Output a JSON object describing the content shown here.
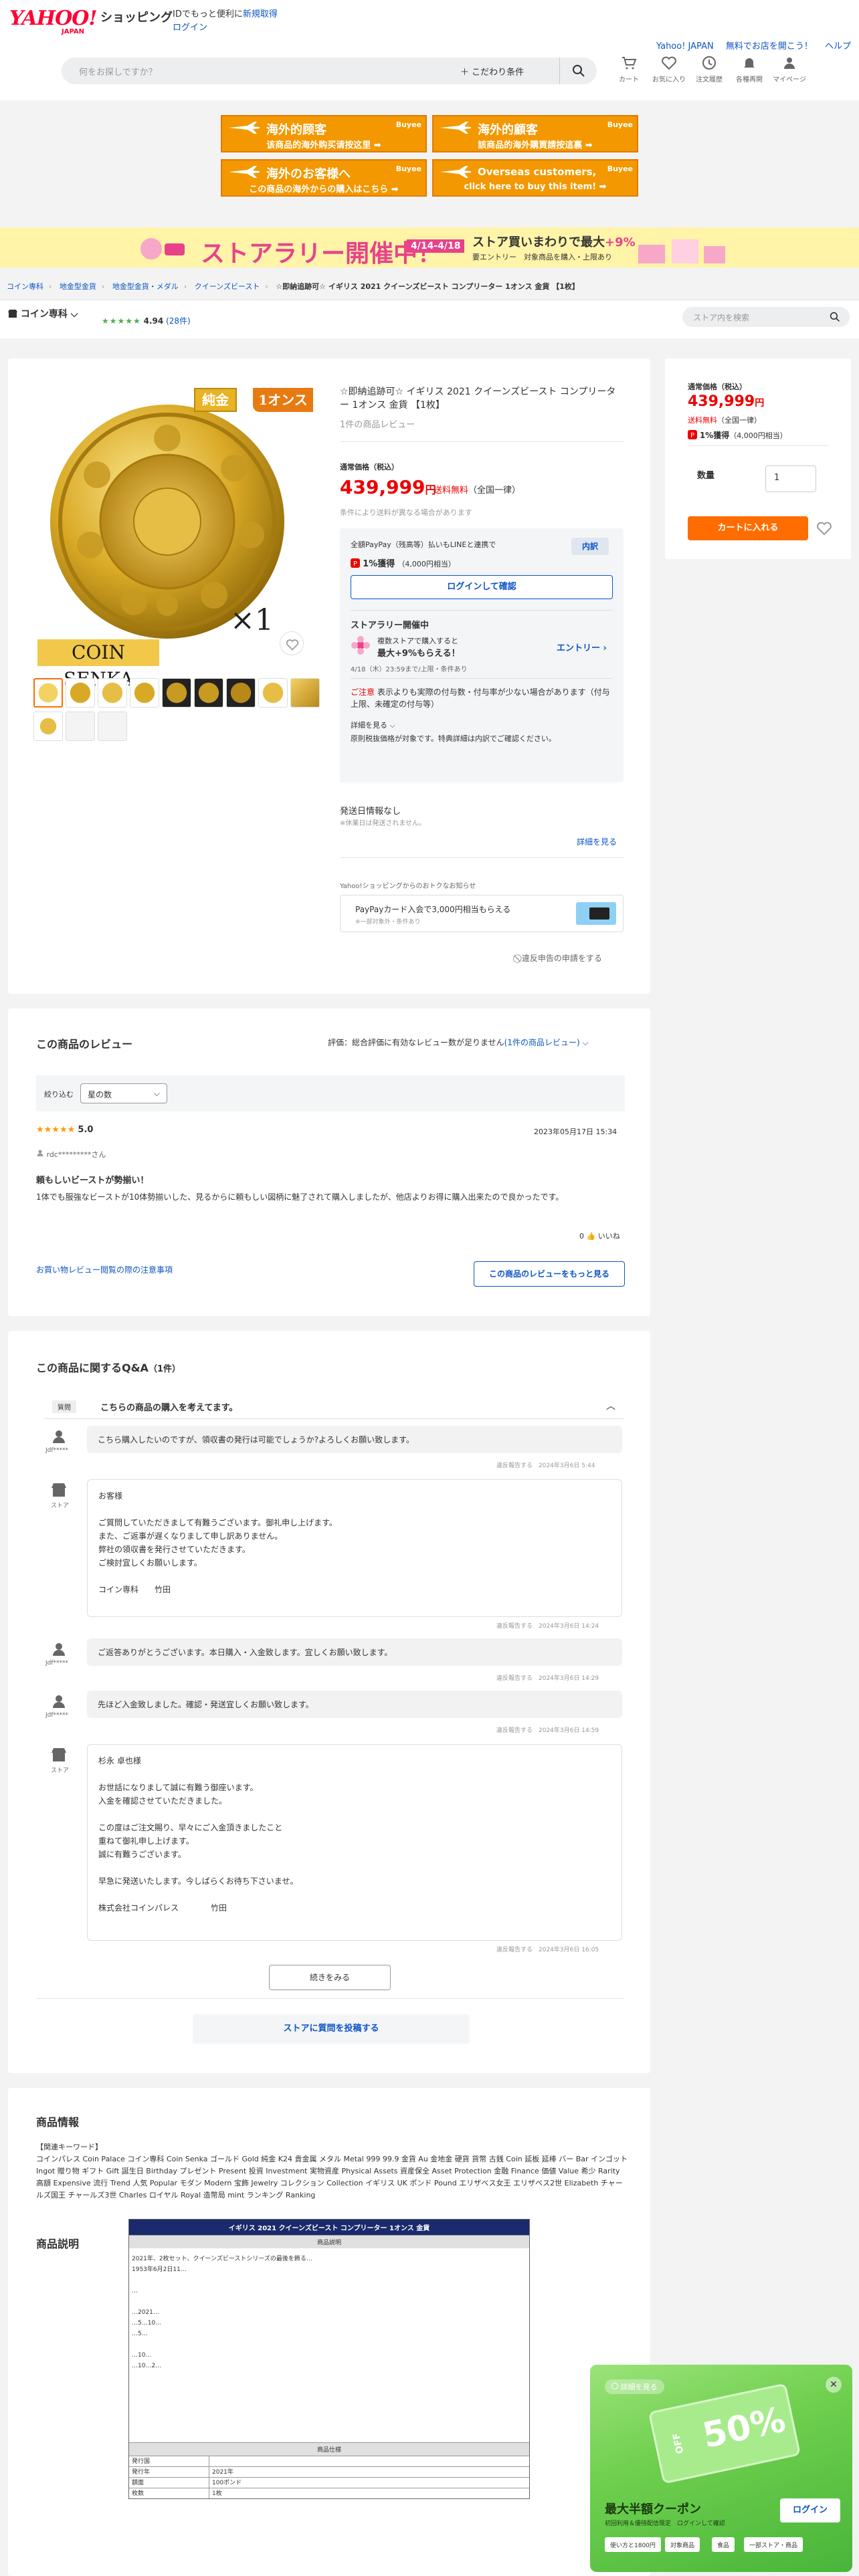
{
  "header": {
    "logo": "YAHOO!",
    "logo_sub": "JAPAN",
    "shopping": "ショッピング",
    "msg_prefix": "IDでもっと便利に",
    "msg_link": "新規取得",
    "login": "ログイン",
    "right_links": [
      "Yahoo! JAPAN",
      "無料でお店を開こう！",
      "ヘルプ"
    ],
    "search_placeholder": "何をお探しですか？",
    "search_condition": "＋ こだわり条件",
    "icons": [
      {
        "name": "cart",
        "label": "カート"
      },
      {
        "name": "favorite",
        "label": "お気に入り"
      },
      {
        "name": "history",
        "label": "注文履歴"
      },
      {
        "name": "notification",
        "label": "各種再開"
      },
      {
        "name": "mypage",
        "label": "マイページ"
      }
    ]
  },
  "banners": [
    {
      "title": "海外的顾客",
      "sub": "该商品的海外购买请按这里 ➡",
      "brand": "Buyee"
    },
    {
      "title": "海外的顧客",
      "sub": "該商品的海外購買請按這裏 ➡",
      "brand": "Buyee"
    },
    {
      "title": "海外のお客様へ",
      "sub": "この商品の海外からの購入はこちら ➡",
      "brand": "Buyee"
    },
    {
      "title": "Overseas customers,",
      "sub": "click here to buy this item! ➡",
      "brand": "Buyee"
    }
  ],
  "rally": {
    "title": "ストアラリー開催中！",
    "date": "4/14-4/18",
    "line1_a": "ストア買いまわりで最大",
    "line1_b": "+9%",
    "line2": "要エントリー　対象商品を購入・上限あり"
  },
  "breadcrumb": [
    "コイン専科",
    "地金型金貨",
    "地金型金貨・メダル",
    "クイーンズビースト",
    "☆即納追跡可☆ イギリス 2021 クイーンズビースト コンプリーター 1オンス 金貨 【1枚】"
  ],
  "store": {
    "name": "コイン専科",
    "stars": "★★★★★",
    "rating": "4.94",
    "count": "(28件)",
    "search_placeholder": "ストア内を検索"
  },
  "product": {
    "image_badge1": "純金",
    "image_badge2": "1オンス",
    "image_brand": "COIN SENKA",
    "image_qty": "×1",
    "title": "☆即納追跡可☆ イギリス 2021 クイーンズビースト コンプリーター 1オンス 金貨 【1枚】",
    "reviews_link": "1件の商品レビュー",
    "price_label": "通常価格（税込）",
    "price": "439,999",
    "price_unit": "円",
    "shipping": "送料無料",
    "shipping_note": "（全国一律）",
    "price_note": "条件により送料が異なる場合があります",
    "paypay_line": "全額PayPay（残高等）払いもLINEと連携で",
    "detail_btn": "内訳",
    "points": "1%獲得",
    "points_sub": "（4,000円相当）",
    "login_confirm": "ログインして確認",
    "rally_head": "ストアラリー開催中",
    "rally_l1": "複数ストアで購入すると",
    "rally_l2": "最大+9%もらえる！",
    "entry": "エントリー ›",
    "rally_time": "4/18（木）23:59まで/上限・条件あり",
    "caution_head": "ご注意",
    "caution": "表示よりも実際の付与数・付与率が少ない場合があります（付与上限、未確定の付与等）",
    "see_detail": "詳細を見る ⌵",
    "tax_note": "原則税抜価格が対象です。特典詳細は内訳でご確認ください。",
    "ship_date": "発送日情報なし",
    "ship_date_note": "※休業日は発送されません。",
    "see_more": "詳細を見る",
    "paypay_card_head": "Yahoo!ショッピングからのおトクなお知らせ",
    "paypay_card": "PayPayカード入会で3,000円相当もらえる",
    "paypay_card_sub": "※一部対象外・条件あり",
    "report": "⃠ 違反申告の申請をする"
  },
  "side": {
    "label": "通常価格（税込）",
    "price": "439,999",
    "unit": "円",
    "shipping": "送料無料",
    "shipping_note": "（全国一律）",
    "points": "1%獲得",
    "points_sub": "（4,000円相当）",
    "qty_label": "数量",
    "qty_value": "1",
    "cart_btn": "カートに入れる"
  },
  "reviews": {
    "title": "この商品のレビュー",
    "summary_text": "評価：総合評価に有効なレビュー数が足りません",
    "summary_link": "(1件の商品レビュー)",
    "filter_label": "絞り込む",
    "filter_value": "星の数",
    "stars": "★★★★★",
    "score": "5.0",
    "date": "2023年05月17日 15:34",
    "user": "rdc*********さん",
    "headline": "頼もしいビーストが勢揃い！",
    "body": "1体でも服強なビーストが10体勢揃いした、見るからに頼もしい図柄に魅了されて購入しましたが、他店よりお得に購入出来たので良かったです。",
    "likes": "0",
    "like_label": "いいね",
    "notice_link": "お買い物レビュー閲覧の際の注意事項",
    "more_btn": "この商品のレビューをもっと見る"
  },
  "qa": {
    "title": "この商品に関するQ&A",
    "count": "（1件）",
    "tag": "質問",
    "question_title": "こちらの商品の購入を考えてます。",
    "items": [
      {
        "role": "user",
        "user": "Jdf*****",
        "text": "こちら購入したいのですが、領収書の発行は可能でしょうか?よろしくお願い致します。",
        "meta": "違反報告する　2024年3月6日 5:44"
      },
      {
        "role": "store",
        "user": "ストア",
        "text": "お客様\n\nご質問していただきまして有難うございます。御礼申し上げます。\nまた、ご返事が遅くなりまして申し訳ありません。\n弊社の領収書を発行させていただきます。\nご検討宜しくお願いします。\n\nコイン専科　　竹田",
        "meta": "違反報告する　2024年3月6日 14:24"
      },
      {
        "role": "user",
        "user": "Jdf*****",
        "text": "ご返答ありがとうございます。本日購入・入金致します。宜しくお願い致します。",
        "meta": "違反報告する　2024年3月6日 14:29"
      },
      {
        "role": "user",
        "user": "Jdf*****",
        "text": "先ほど入金致しました。確認・発送宜しくお願い致します。",
        "meta": "違反報告する　2024年3月6日 14:59"
      },
      {
        "role": "store",
        "user": "ストア",
        "text": "杉永 卓也様\n\nお世話になりまして誠に有難う御座います。\n入金を確認させていただきました。\n\nこの度はご注文賜り、早々にご入金頂きましたこと\n重ねて御礼申し上げます。\n誠に有難うございます。\n\n早急に発送いたします。今しばらくお待ち下さいませ。\n\n株式会社コインパレス　　　　竹田",
        "meta": "違反報告する　2024年3月6日 16:05"
      }
    ],
    "continue_btn": "続きをみる",
    "post_btn": "ストアに質問を投稿する"
  },
  "info": {
    "title": "商品情報",
    "keywords": "【関連キーワード】\nコインパレス Coin Palace コイン専科 Coin Senka ゴールド Gold 純金 K24 貴金属 メタル Metal 999 99.9 金貨 Au 金地金 硬貨 貨幣 古銭 Coin 延板 延棒 バー Bar インゴット Ingot 贈り物 ギフト Gift 誕生日 Birthday プレゼント Present 投資 Investment 実物資産 Physical Assets 資産保全 Asset Protection 金融 Finance 価値 Value 希少 Rarity 高額 Expensive 流行 Trend 人気 Popular モダン Modern 宝飾 Jewelry コレクション Collection イギリス UK ポンド Pound エリザベス女王 エリザベス2世 Elizabeth チャールズ国王 チャールズ3世 Charles ロイヤル Royal 造幣局 mint ランキング Ranking",
    "desc_title": "商品説明",
    "table_title": "イギリス 2021 クイーンズビースト コンプリーター 1オンス 金貨",
    "table_sub": "商品説明",
    "table_body": "2021年、2枚セット、クイーンズビーストシリーズの最後を飾る…\n1953年6月2日11…\n\n…\n\n…2021…\n…5…10…\n…5…\n\n…10…\n…10…2…\n",
    "spec_sub": "商品仕様",
    "spec_rows": [
      [
        "発行国",
        ""
      ],
      [
        "発行年",
        "2021年"
      ],
      [
        "額面",
        "100ポンド"
      ],
      [
        "枚数",
        "1枚"
      ]
    ]
  },
  "coupon": {
    "tag": "詳細を見る",
    "percent": "50%",
    "off": "OFF",
    "title": "最大半額クーポン",
    "sub": "初回利用＆優待配信限定　ログインして確認",
    "login": "ログイン",
    "chips": [
      "使い方と1800円",
      "対象商品",
      "食品",
      "一部ストア・商品"
    ]
  },
  "colors": {
    "accent_red": "#ee0000",
    "link_blue": "#0d55c4",
    "buyee_orange": "#f39800",
    "rally_pink": "#e8428a",
    "cart_orange": "#ff6d00",
    "star_green": "#4caf50"
  }
}
